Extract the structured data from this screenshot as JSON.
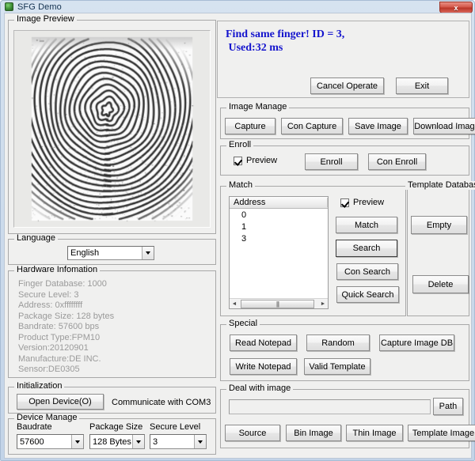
{
  "window": {
    "title": "SFG Demo",
    "app_icon": "app-icon",
    "close_label": "x"
  },
  "image_preview": {
    "caption": "Image Preview"
  },
  "message": {
    "text": "Find same finger! ID = 3,\n Used:32 ms",
    "color": "#1414cd",
    "cancel_label": "Cancel Operate",
    "exit_label": "Exit"
  },
  "image_manage": {
    "caption": "Image Manage",
    "buttons": [
      {
        "label": "Capture"
      },
      {
        "label": "Con Capture"
      },
      {
        "label": "Save Image"
      },
      {
        "label": "Download Image"
      }
    ]
  },
  "enroll": {
    "caption": "Enroll",
    "preview_label": "Preview",
    "preview_checked": true,
    "buttons": [
      {
        "label": "Enroll"
      },
      {
        "label": "Con Enroll"
      }
    ]
  },
  "match": {
    "caption": "Match",
    "list_column": "Address",
    "list_rows": [
      "0",
      "1",
      "3"
    ],
    "preview_label": "Preview",
    "preview_checked": true,
    "buttons": [
      {
        "label": "Match"
      },
      {
        "label": "Search"
      },
      {
        "label": "Con Search"
      },
      {
        "label": "Quick Search"
      }
    ],
    "scroll_left": "◄",
    "scroll_right": "►",
    "scroll_grip": "|||"
  },
  "template_database": {
    "caption": "Template Database",
    "buttons": [
      {
        "label": "Empty"
      },
      {
        "label": "Delete"
      }
    ]
  },
  "special": {
    "caption": "Special",
    "buttons": [
      {
        "label": "Read Notepad"
      },
      {
        "label": "Random"
      },
      {
        "label": "Capture Image DB"
      },
      {
        "label": "Write Notepad"
      },
      {
        "label": "Valid Template"
      }
    ]
  },
  "deal_with_image": {
    "caption": "Deal with image",
    "path_value": "",
    "path_button": "Path",
    "buttons": [
      {
        "label": "Source"
      },
      {
        "label": "Bin Image"
      },
      {
        "label": "Thin Image"
      },
      {
        "label": "Template Image"
      }
    ]
  },
  "language": {
    "caption": "Language",
    "selected": "English"
  },
  "hardware_information": {
    "caption": "Hardware Infomation",
    "lines": [
      "Finger Database: 1000",
      "Secure Level: 3",
      "Address: 0xffffffff",
      "Package Size: 128 bytes",
      "Bandrate: 57600 bps",
      "Product Type:FPM10",
      "Version:20120901",
      "Manufacture:DE INC.",
      "Sensor:DE0305"
    ]
  },
  "initialization": {
    "caption": "Initialization",
    "open_device_label": "Open Device(O)",
    "status_text": "Communicate with COM3"
  },
  "device_manage": {
    "caption": "Device Manage",
    "fields": [
      {
        "label": "Baudrate",
        "value": "57600"
      },
      {
        "label": "Package Size",
        "value": "128 Bytes"
      },
      {
        "label": "Secure Level",
        "value": "3"
      }
    ]
  }
}
